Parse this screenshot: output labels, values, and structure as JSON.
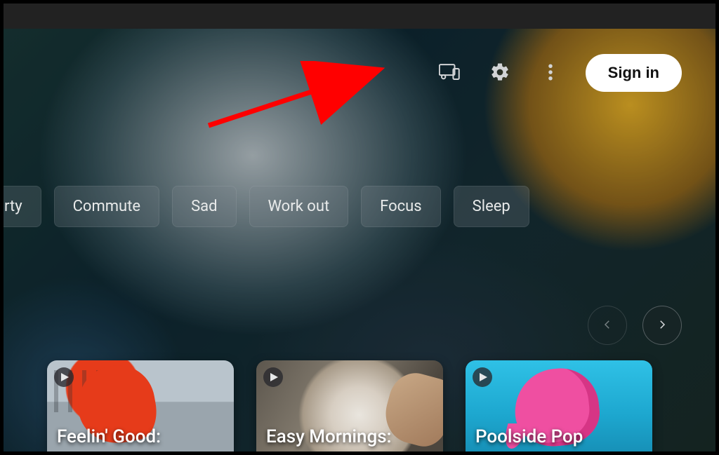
{
  "header": {
    "sign_in_label": "Sign in"
  },
  "mood_chips": {
    "partial_leading": "rty",
    "items": [
      "Commute",
      "Sad",
      "Work out",
      "Focus",
      "Sleep"
    ]
  },
  "carousel": {
    "cards": [
      {
        "title": "Feelin' Good:"
      },
      {
        "title": "Easy Mornings:"
      },
      {
        "title": "Poolside Pop"
      }
    ]
  }
}
